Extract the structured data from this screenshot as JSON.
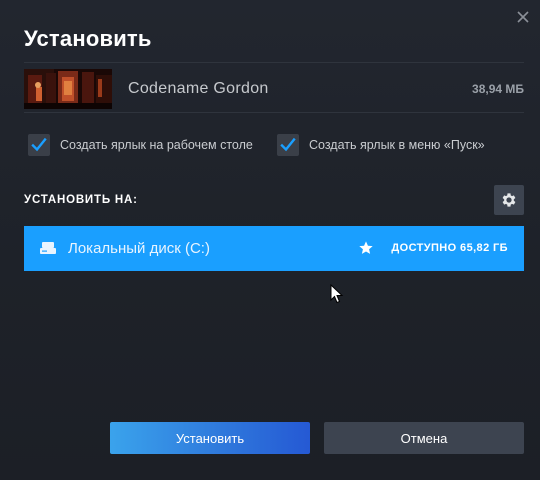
{
  "dialog": {
    "title": "Установить",
    "close_icon": "close-icon"
  },
  "game": {
    "name": "Codename Gordon",
    "size": "38,94 МБ"
  },
  "options": {
    "desktop_shortcut": {
      "label": "Создать ярлык на рабочем столе",
      "checked": true
    },
    "start_menu_shortcut": {
      "label": "Создать ярлык в меню «Пуск»",
      "checked": true
    }
  },
  "install_location": {
    "label": "УСТАНОВИТЬ НА:",
    "settings_icon": "gear-icon",
    "drive": {
      "name": "Локальный диск (C:)",
      "available": "ДОСТУПНО 65,82 ГБ",
      "icon": "drive-icon",
      "default_icon": "star-icon"
    }
  },
  "buttons": {
    "install": "Установить",
    "cancel": "Отмена"
  },
  "colors": {
    "accent": "#1a9fff",
    "background": "#22262f",
    "button_secondary": "#3d4450"
  }
}
